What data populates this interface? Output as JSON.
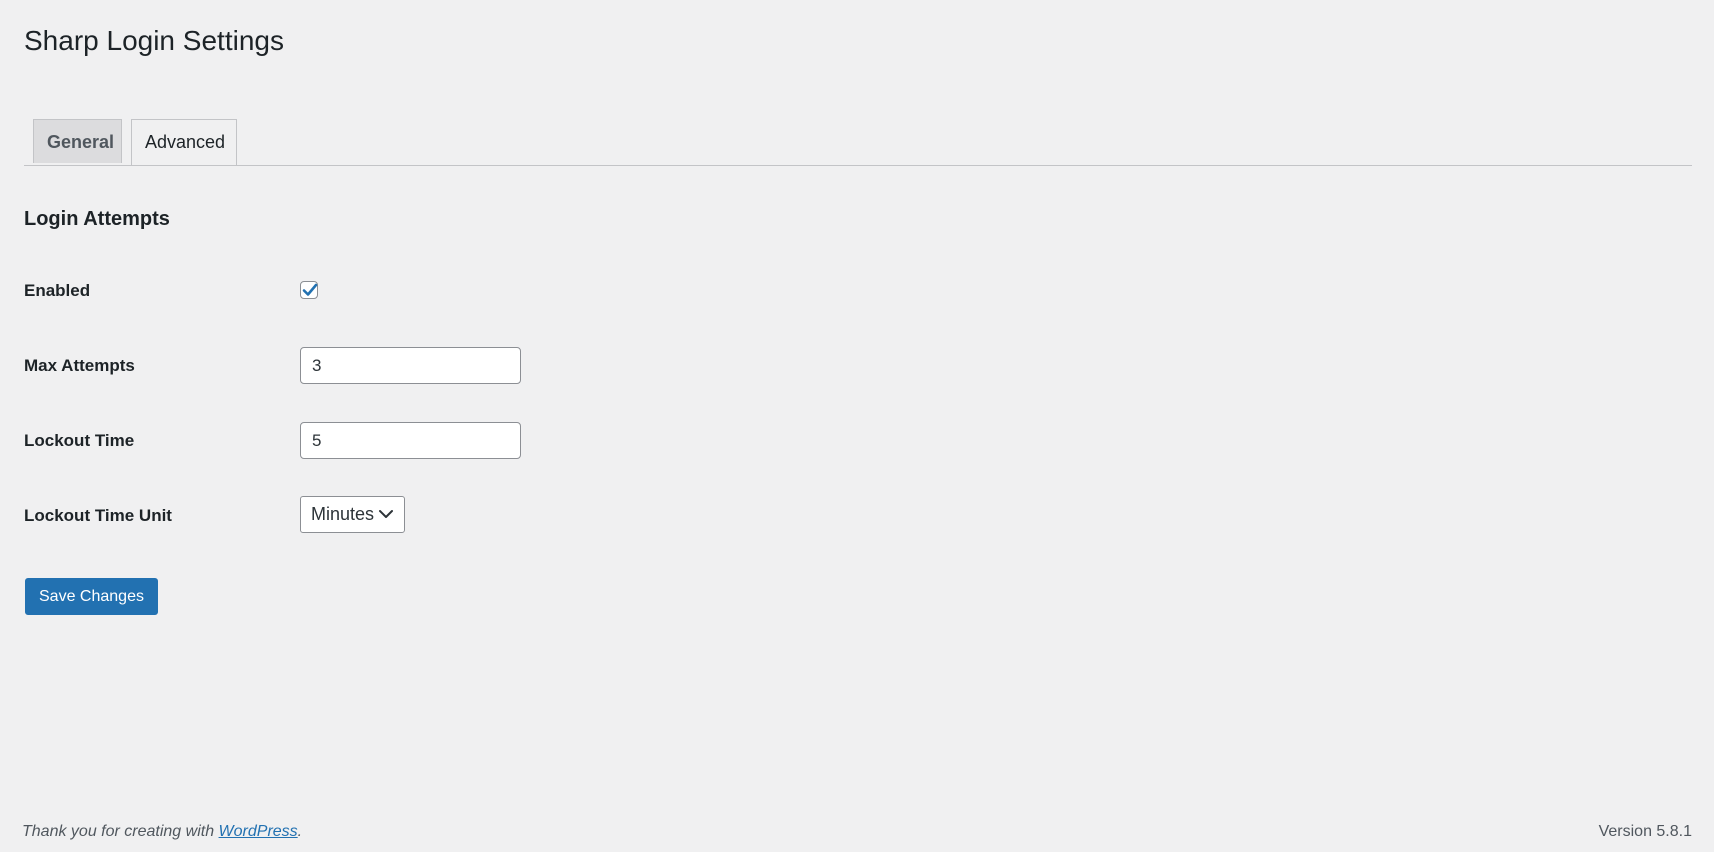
{
  "page": {
    "title": "Sharp Login Settings"
  },
  "tabs": [
    {
      "label": "General",
      "active": false
    },
    {
      "label": "Advanced",
      "active": true
    }
  ],
  "section": {
    "title": "Login Attempts"
  },
  "fields": {
    "enabled": {
      "label": "Enabled",
      "checked": true
    },
    "max_attempts": {
      "label": "Max Attempts",
      "value": "3"
    },
    "lockout_time": {
      "label": "Lockout Time",
      "value": "5"
    },
    "lockout_time_unit": {
      "label": "Lockout Time Unit",
      "selected": "Minutes"
    }
  },
  "actions": {
    "save_label": "Save Changes"
  },
  "footer": {
    "thanks_prefix": "Thank you for creating with ",
    "thanks_link": "WordPress",
    "thanks_suffix": ".",
    "version": "Version 5.8.1"
  },
  "colors": {
    "background": "#f0f0f1",
    "primary": "#2271b1",
    "text": "#1d2327"
  }
}
